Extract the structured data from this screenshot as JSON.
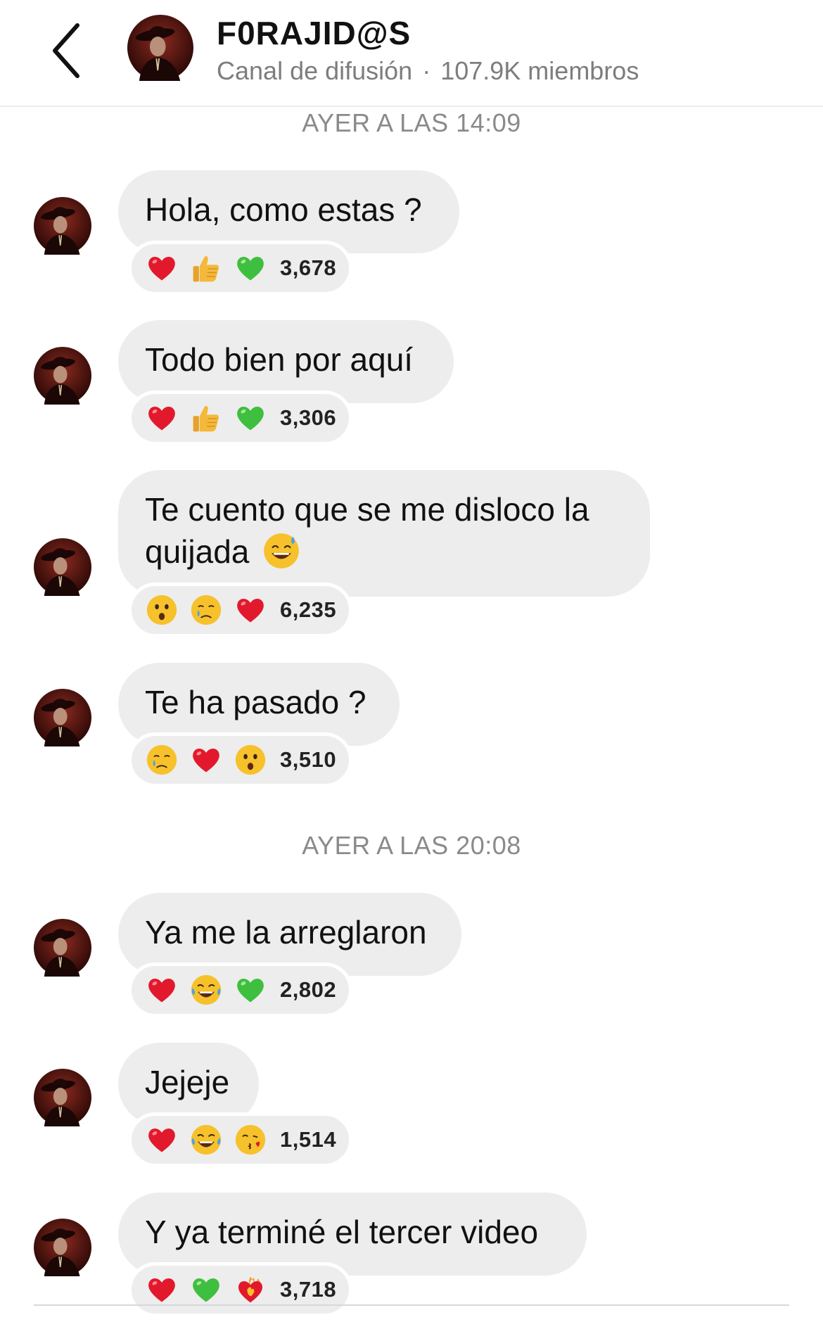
{
  "header": {
    "title": "F0RAJID@S",
    "channel_type": "Canal de difusión",
    "separator": "·",
    "members": "107.9K miembros"
  },
  "timestamps": [
    "AYER A LAS 14:09",
    "AYER A LAS 20:08"
  ],
  "messages": [
    {
      "text": "Hola, como estas ?",
      "reactions": [
        "heart-icon",
        "thumbs-up-icon",
        "green-heart-icon"
      ],
      "count": "3,678"
    },
    {
      "text": "Todo bien por aquí",
      "reactions": [
        "heart-icon",
        "thumbs-up-icon",
        "green-heart-icon"
      ],
      "count": "3,306"
    },
    {
      "text_line1": "Te cuento que se me disloco la",
      "text_line2": "quijada",
      "inline_emoji": "grinning-sweat-icon",
      "reactions": [
        "surprised-face-icon",
        "crying-face-icon",
        "heart-icon"
      ],
      "count": "6,235"
    },
    {
      "text": "Te ha pasado ?",
      "reactions": [
        "crying-face-icon",
        "heart-icon",
        "surprised-face-icon"
      ],
      "count": "3,510"
    },
    {
      "text": "Ya me la arreglaron",
      "reactions": [
        "heart-icon",
        "tears-of-joy-icon",
        "green-heart-icon"
      ],
      "count": "2,802"
    },
    {
      "text": "Jejeje",
      "reactions": [
        "heart-icon",
        "tears-of-joy-icon",
        "kissing-heart-face-icon"
      ],
      "count": "1,514"
    },
    {
      "text": "Y ya terminé el tercer video",
      "reactions": [
        "heart-icon",
        "green-heart-icon",
        "heart-on-fire-icon"
      ],
      "count": "3,718"
    }
  ],
  "colors": {
    "bubble": "#ededed",
    "muted_text": "#8a8a8a",
    "heart_red": "#e2192c",
    "heart_green": "#3fbf3f",
    "emoji_yellow": "#f6c12b"
  }
}
